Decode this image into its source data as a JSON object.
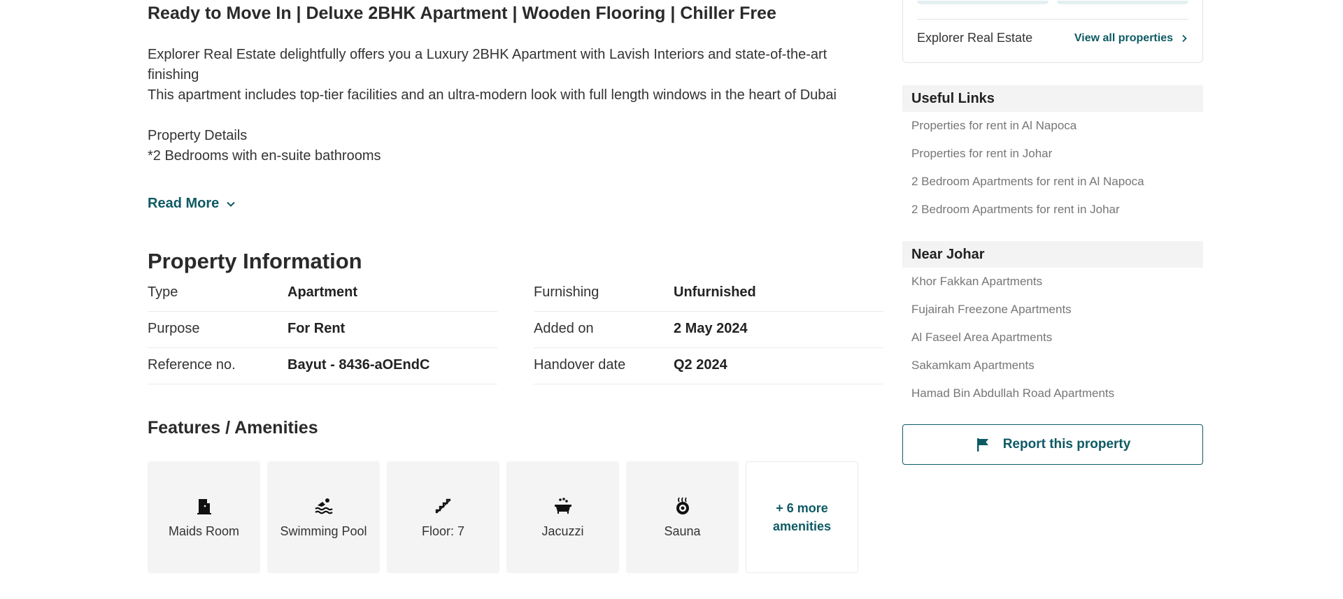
{
  "listing": {
    "title": "Ready to Move In | Deluxe 2BHK Apartment | Wooden Flooring | Chiller Free",
    "description": [
      "Explorer Real Estate delightfully offers you a Luxury 2BHK Apartment with Lavish Interiors and state-of-the-art finishing",
      "This apartment includes top-tier facilities and an ultra-modern look with full length windows in the heart of Dubai",
      "",
      "Property Details",
      "*2 Bedrooms with en-suite bathrooms"
    ],
    "read_more": "Read More"
  },
  "property_info": {
    "title": "Property Information",
    "left": [
      {
        "label": "Type",
        "value": "Apartment"
      },
      {
        "label": "Purpose",
        "value": "For Rent"
      },
      {
        "label": "Reference no.",
        "value": "Bayut - 8436-aOEndC"
      }
    ],
    "right": [
      {
        "label": "Furnishing",
        "value": "Unfurnished"
      },
      {
        "label": "Added on",
        "value": "2 May 2024"
      },
      {
        "label": "Handover date",
        "value": "Q2 2024"
      }
    ]
  },
  "features": {
    "title": "Features / Amenities",
    "items": [
      {
        "label": "Maids Room",
        "icon": "door-icon"
      },
      {
        "label": "Swimming Pool",
        "icon": "swimmer-icon"
      },
      {
        "label": "Floor: 7",
        "icon": "stairs-icon"
      },
      {
        "label": "Jacuzzi",
        "icon": "bathtub-icon"
      },
      {
        "label": "Sauna",
        "icon": "sauna-icon"
      }
    ],
    "more_line1": "+ 6 more",
    "more_line2": "amenities"
  },
  "agent": {
    "name": "Explorer Real Estate",
    "view_all": "View all properties"
  },
  "useful_links": {
    "title": "Useful Links",
    "items": [
      "Properties for rent in Al Napoca",
      "Properties for rent in Johar",
      "2 Bedroom Apartments for rent in Al Napoca",
      "2 Bedroom Apartments for rent in Johar"
    ]
  },
  "near": {
    "title": "Near Johar",
    "items": [
      "Khor Fakkan Apartments",
      "Fujairah Freezone Apartments",
      "Al Faseel Area Apartments",
      "Sakamkam Apartments",
      "Hamad Bin Abdullah Road Apartments"
    ]
  },
  "report": {
    "label": "Report this property"
  },
  "colors": {
    "accent": "#0e5a64",
    "panel": "#f4f4f4",
    "link_gray": "#767676"
  }
}
